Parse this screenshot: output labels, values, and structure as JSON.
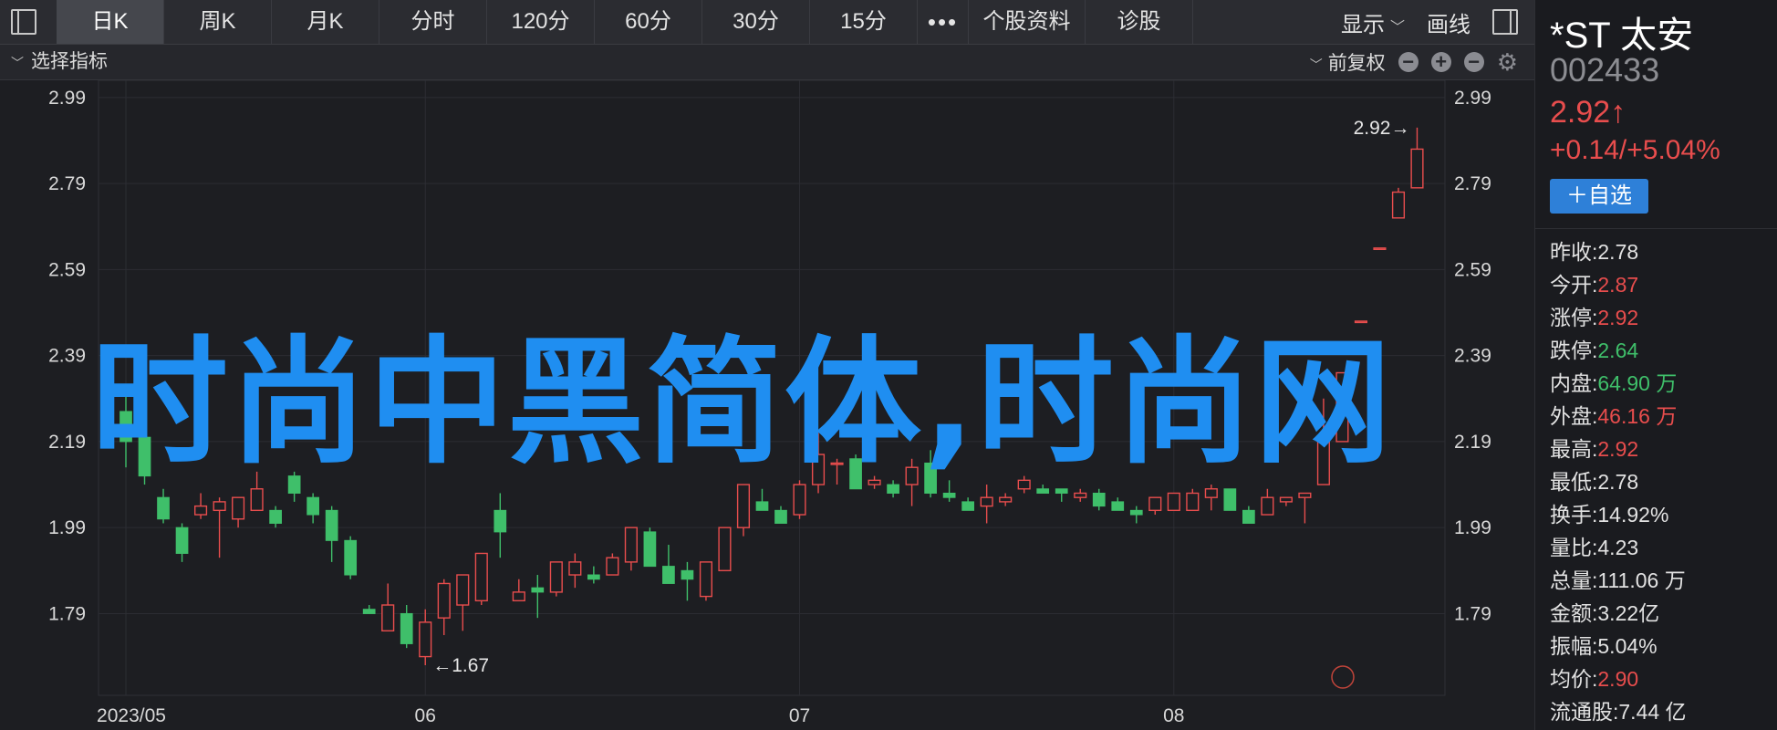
{
  "toolbar": {
    "tabs": [
      {
        "label": "日K",
        "active": true
      },
      {
        "label": "周K"
      },
      {
        "label": "月K"
      },
      {
        "label": "分时"
      },
      {
        "label": "120分"
      },
      {
        "label": "60分"
      },
      {
        "label": "30分"
      },
      {
        "label": "15分"
      },
      {
        "label": "•••"
      },
      {
        "label": "个股资料"
      },
      {
        "label": "诊股"
      }
    ],
    "display_label": "显示",
    "draw_label": "画线"
  },
  "indicator_bar": {
    "select_label": "选择指标",
    "adjust_label": "前复权"
  },
  "chart_data": {
    "type": "candlestick",
    "y_ticks": [
      "2.99",
      "2.79",
      "2.59",
      "2.39",
      "2.19",
      "1.99",
      "1.79"
    ],
    "ylim": [
      1.6,
      3.03
    ],
    "x_ticks": [
      {
        "label": "2023/05",
        "index": 0
      },
      {
        "label": "06",
        "index": 16
      },
      {
        "label": "07",
        "index": 36
      },
      {
        "label": "08",
        "index": 56
      }
    ],
    "max_label": "2.92",
    "min_label": "1.67",
    "up_color": "#e84d4d",
    "down_color": "#3fbf6a",
    "candles": [
      [
        2.26,
        2.3,
        2.13,
        2.19
      ],
      [
        2.2,
        2.21,
        2.09,
        2.11
      ],
      [
        2.06,
        2.08,
        2.0,
        2.01
      ],
      [
        1.99,
        2.0,
        1.91,
        1.93
      ],
      [
        2.02,
        2.07,
        2.01,
        2.04
      ],
      [
        2.03,
        2.06,
        1.92,
        2.05
      ],
      [
        2.01,
        2.04,
        1.99,
        2.06
      ],
      [
        2.03,
        2.12,
        2.03,
        2.08
      ],
      [
        2.03,
        2.04,
        1.99,
        2.0
      ],
      [
        2.11,
        2.12,
        2.05,
        2.07
      ],
      [
        2.06,
        2.07,
        2.0,
        2.02
      ],
      [
        2.03,
        2.04,
        1.91,
        1.96
      ],
      [
        1.96,
        1.97,
        1.87,
        1.88
      ],
      [
        1.8,
        1.81,
        1.79,
        1.79
      ],
      [
        1.75,
        1.86,
        1.75,
        1.81
      ],
      [
        1.79,
        1.81,
        1.71,
        1.72
      ],
      [
        1.69,
        1.8,
        1.67,
        1.77
      ],
      [
        1.78,
        1.87,
        1.74,
        1.86
      ],
      [
        1.81,
        1.88,
        1.75,
        1.88
      ],
      [
        1.82,
        1.93,
        1.81,
        1.93
      ],
      [
        2.03,
        2.07,
        1.92,
        1.98
      ],
      [
        1.82,
        1.87,
        1.82,
        1.84
      ],
      [
        1.85,
        1.88,
        1.78,
        1.84
      ],
      [
        1.84,
        1.91,
        1.83,
        1.91
      ],
      [
        1.88,
        1.93,
        1.85,
        1.91
      ],
      [
        1.88,
        1.9,
        1.86,
        1.87
      ],
      [
        1.88,
        1.93,
        1.88,
        1.92
      ],
      [
        1.91,
        1.99,
        1.89,
        1.99
      ],
      [
        1.98,
        1.99,
        1.91,
        1.9
      ],
      [
        1.9,
        1.95,
        1.88,
        1.86
      ],
      [
        1.89,
        1.91,
        1.82,
        1.87
      ],
      [
        1.83,
        1.88,
        1.82,
        1.91
      ],
      [
        1.89,
        1.99,
        1.89,
        1.99
      ],
      [
        1.99,
        2.08,
        1.97,
        2.09
      ],
      [
        2.05,
        2.08,
        2.03,
        2.03
      ],
      [
        2.03,
        2.04,
        2.01,
        2.0
      ],
      [
        2.02,
        2.1,
        2.01,
        2.09
      ],
      [
        2.09,
        2.21,
        2.07,
        2.16
      ],
      [
        2.14,
        2.15,
        2.09,
        2.14
      ],
      [
        2.15,
        2.16,
        2.08,
        2.08
      ],
      [
        2.09,
        2.11,
        2.08,
        2.1
      ],
      [
        2.09,
        2.1,
        2.06,
        2.07
      ],
      [
        2.09,
        2.15,
        2.04,
        2.13
      ],
      [
        2.14,
        2.17,
        2.06,
        2.07
      ],
      [
        2.07,
        2.1,
        2.05,
        2.06
      ],
      [
        2.05,
        2.06,
        2.04,
        2.03
      ],
      [
        2.04,
        2.09,
        2.0,
        2.06
      ],
      [
        2.05,
        2.07,
        2.04,
        2.06
      ],
      [
        2.08,
        2.11,
        2.07,
        2.1
      ],
      [
        2.08,
        2.09,
        2.07,
        2.07
      ],
      [
        2.08,
        2.08,
        2.05,
        2.07
      ],
      [
        2.06,
        2.08,
        2.05,
        2.07
      ],
      [
        2.07,
        2.08,
        2.03,
        2.04
      ],
      [
        2.05,
        2.06,
        2.03,
        2.03
      ],
      [
        2.03,
        2.04,
        2.0,
        2.02
      ],
      [
        2.03,
        2.06,
        2.02,
        2.06
      ],
      [
        2.03,
        2.07,
        2.03,
        2.07
      ],
      [
        2.03,
        2.08,
        2.03,
        2.07
      ],
      [
        2.06,
        2.09,
        2.03,
        2.08
      ],
      [
        2.08,
        2.08,
        2.05,
        2.03
      ],
      [
        2.03,
        2.04,
        2.0,
        2.0
      ],
      [
        2.02,
        2.08,
        2.03,
        2.06
      ],
      [
        2.05,
        2.06,
        2.04,
        2.06
      ],
      [
        2.06,
        2.07,
        2.0,
        2.07
      ],
      [
        2.09,
        2.29,
        2.09,
        2.19
      ],
      [
        2.19,
        2.35,
        2.19,
        2.35
      ],
      [
        2.47,
        2.47,
        2.47,
        2.47
      ],
      [
        2.64,
        2.64,
        2.64,
        2.64
      ],
      [
        2.71,
        2.78,
        2.71,
        2.77
      ],
      [
        2.78,
        2.92,
        2.78,
        2.87
      ]
    ]
  },
  "watermark_text": "时尚中黑简体,时尚网",
  "sidebar": {
    "name": "*ST 太安",
    "code": "002433",
    "price": "2.92↑",
    "change": "+0.14/+5.04%",
    "add_button": "＋自选",
    "stats": [
      {
        "label": "昨收:",
        "value": "2.78",
        "color": "normal"
      },
      {
        "label": "今开:",
        "value": "2.87",
        "color": "red"
      },
      {
        "label": "涨停:",
        "value": "2.92",
        "color": "red"
      },
      {
        "label": "跌停:",
        "value": "2.64",
        "color": "green"
      },
      {
        "label": "内盘:",
        "value": "64.90 万",
        "color": "green"
      },
      {
        "label": "外盘:",
        "value": "46.16 万",
        "color": "red"
      },
      {
        "label": "最高:",
        "value": "2.92",
        "color": "red"
      },
      {
        "label": "最低:",
        "value": "2.78",
        "color": "normal"
      },
      {
        "label": "换手:",
        "value": "14.92%",
        "color": "normal"
      },
      {
        "label": "量比:",
        "value": "4.23",
        "color": "normal"
      },
      {
        "label": "总量:",
        "value": "111.06 万",
        "color": "normal"
      },
      {
        "label": "金额:",
        "value": "3.22亿",
        "color": "normal"
      },
      {
        "label": "振幅:",
        "value": "5.04%",
        "color": "normal"
      },
      {
        "label": "均价:",
        "value": "2.90",
        "color": "red"
      },
      {
        "label": "流通股:",
        "value": "7.44 亿",
        "color": "normal"
      }
    ]
  }
}
